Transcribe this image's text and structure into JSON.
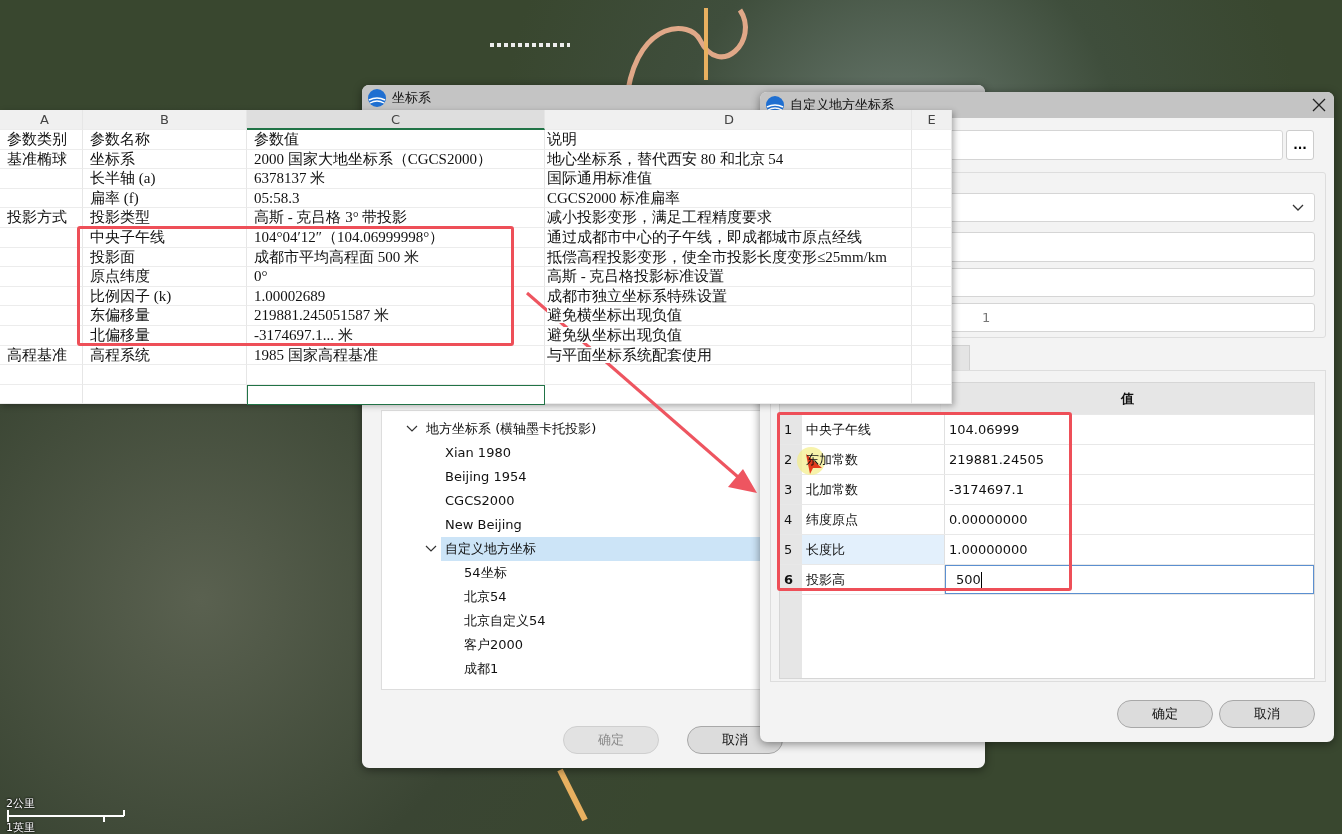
{
  "map": {
    "scale_bar": {
      "metric": "2公里",
      "imperial": "1英里"
    }
  },
  "coord_dialog": {
    "title": "坐标系",
    "tree": [
      {
        "label": "地方坐标系 (横轴墨卡托投影)",
        "expanded": true,
        "selected": false,
        "children": [
          {
            "label": "Xian 1980",
            "selected": false
          },
          {
            "label": "Beijing 1954",
            "selected": false
          },
          {
            "label": "CGCS2000",
            "selected": false
          },
          {
            "label": "New Beijing",
            "selected": false
          },
          {
            "label": "自定义地方坐标",
            "expanded": true,
            "selected": true,
            "children": [
              {
                "label": "54坐标",
                "selected": false
              },
              {
                "label": "北京54",
                "selected": false
              },
              {
                "label": "北京自定义54",
                "selected": false
              },
              {
                "label": "客户2000",
                "selected": false
              },
              {
                "label": "成都1",
                "selected": false
              }
            ]
          }
        ]
      }
    ],
    "buttons": [
      {
        "label": "确定",
        "disabled": true
      },
      {
        "label": "取消",
        "disabled": false
      }
    ]
  },
  "custom_dialog": {
    "title": "自定义地方坐标系",
    "browse_button": "...",
    "fields": [
      {
        "value": "1"
      }
    ],
    "table": {
      "value_header": "值",
      "rows": [
        {
          "number": "1",
          "name": "中央子午线",
          "value": "104.06999",
          "selected": false,
          "editing": false
        },
        {
          "number": "2",
          "name": "东加常数",
          "value": "219881.24505",
          "selected": false,
          "editing": false
        },
        {
          "number": "3",
          "name": "北加常数",
          "value": "-3174697.1",
          "selected": false,
          "editing": false
        },
        {
          "number": "4",
          "name": "纬度原点",
          "value": "0.00000000",
          "selected": false,
          "editing": false
        },
        {
          "number": "5",
          "name": "长度比",
          "value": "1.00000000",
          "selected": true,
          "editing": false
        },
        {
          "number": "6",
          "name": "投影高",
          "value": "500",
          "selected": false,
          "editing": true
        }
      ]
    },
    "buttons": [
      {
        "label": "确定",
        "disabled": false
      },
      {
        "label": "取消",
        "disabled": false
      }
    ]
  },
  "spreadsheet": {
    "columns": [
      {
        "label": "A",
        "selected": false
      },
      {
        "label": "B",
        "selected": false
      },
      {
        "label": "C",
        "selected": true
      },
      {
        "label": "D",
        "selected": false
      },
      {
        "label": "E",
        "selected": false
      }
    ],
    "rows": [
      {
        "category": "参数类别",
        "name": "参数名称",
        "value": "参数值",
        "note": "说明"
      },
      {
        "category": "基准椭球",
        "name": "坐标系",
        "value": "2000 国家大地坐标系（CGCS2000）",
        "note": "地心坐标系，替代西安 80 和北京 54"
      },
      {
        "name": "长半轴 (a)",
        "value": "6378137 米",
        "note": "国际通用标准值"
      },
      {
        "name": "扁率 (f)",
        "value": "05:58.3",
        "note": "CGCS2000 标准扁率"
      },
      {
        "category": "投影方式",
        "name": "投影类型",
        "value": "高斯 - 克吕格 3° 带投影",
        "note": "减小投影变形，满足工程精度要求"
      },
      {
        "name": "中央子午线",
        "value": "104°04′12″（104.06999998°）",
        "note": "通过成都市中心的子午线，即成都城市原点经线"
      },
      {
        "name": "投影面",
        "value": "成都市平均高程面 500 米",
        "note": "抵偿高程投影变形，使全市投影长度变形≤25mm/km"
      },
      {
        "name": "原点纬度",
        "value": "0°",
        "note": "高斯 - 克吕格投影标准设置"
      },
      {
        "name": "比例因子 (k)",
        "value": "1.00002689",
        "note": "成都市独立坐标系特殊设置"
      },
      {
        "name": "东偏移量",
        "value": "219881.245051587 米",
        "note": "避免横坐标出现负值"
      },
      {
        "name": "北偏移量",
        "value": "-3174697.1... 米",
        "note": "避免纵坐标出现负值"
      },
      {
        "category": "高程基准",
        "name": "高程系统",
        "value": "1985 国家高程基准",
        "note": "与平面坐标系统配套使用"
      }
    ]
  }
}
